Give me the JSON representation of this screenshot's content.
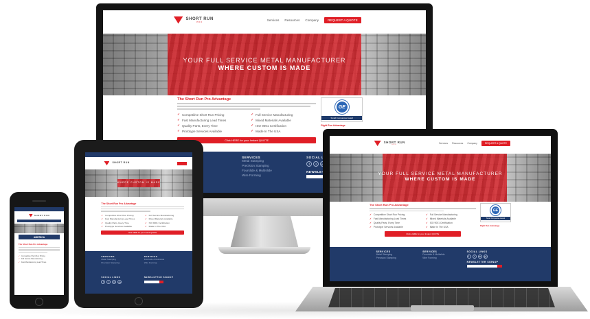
{
  "brand": {
    "name": "SHORT RUN",
    "tagline": "PRO",
    "accent_color": "#e01e26",
    "navy_color": "#213a69"
  },
  "nav": {
    "links": [
      "Services",
      "Resources",
      "Company"
    ],
    "cta": "REQUEST A QUOTE"
  },
  "hero": {
    "line1": "YOUR FULL SERVICE METAL MANUFACTURER",
    "line2": "WHERE CUSTOM IS MADE"
  },
  "advantage": {
    "title": "The Short Run Pro Advantage",
    "checks": [
      "Competitive Short Run Pricing",
      "Fast Manufacturing Lead Times",
      "Quality Parts, Every Time",
      "Prototype Services Available",
      "Full Service Manufacturing",
      "Mixed Materials Available",
      "ISO 9001 Certification",
      "Made In The USA"
    ],
    "button": "Click HERE for your Instant QUOTE",
    "badge_caption": "Small Companies Award",
    "badge_logo": "GE",
    "award_title": "Right Run Advantage"
  },
  "phone": {
    "banner": "AMERICA",
    "title": "The Short Run Pro Advantage"
  },
  "footer": {
    "services_title": "SERVICES",
    "services": [
      "Metal Stamping",
      "Precision Stamping",
      "Fourslide & Multislide",
      "Wire Forming"
    ],
    "social_title": "SOCIAL LINKS",
    "newsletter_title": "NEWSLETTER SIGNUP",
    "social_icons": [
      "f",
      "t",
      "in",
      "g+"
    ]
  }
}
